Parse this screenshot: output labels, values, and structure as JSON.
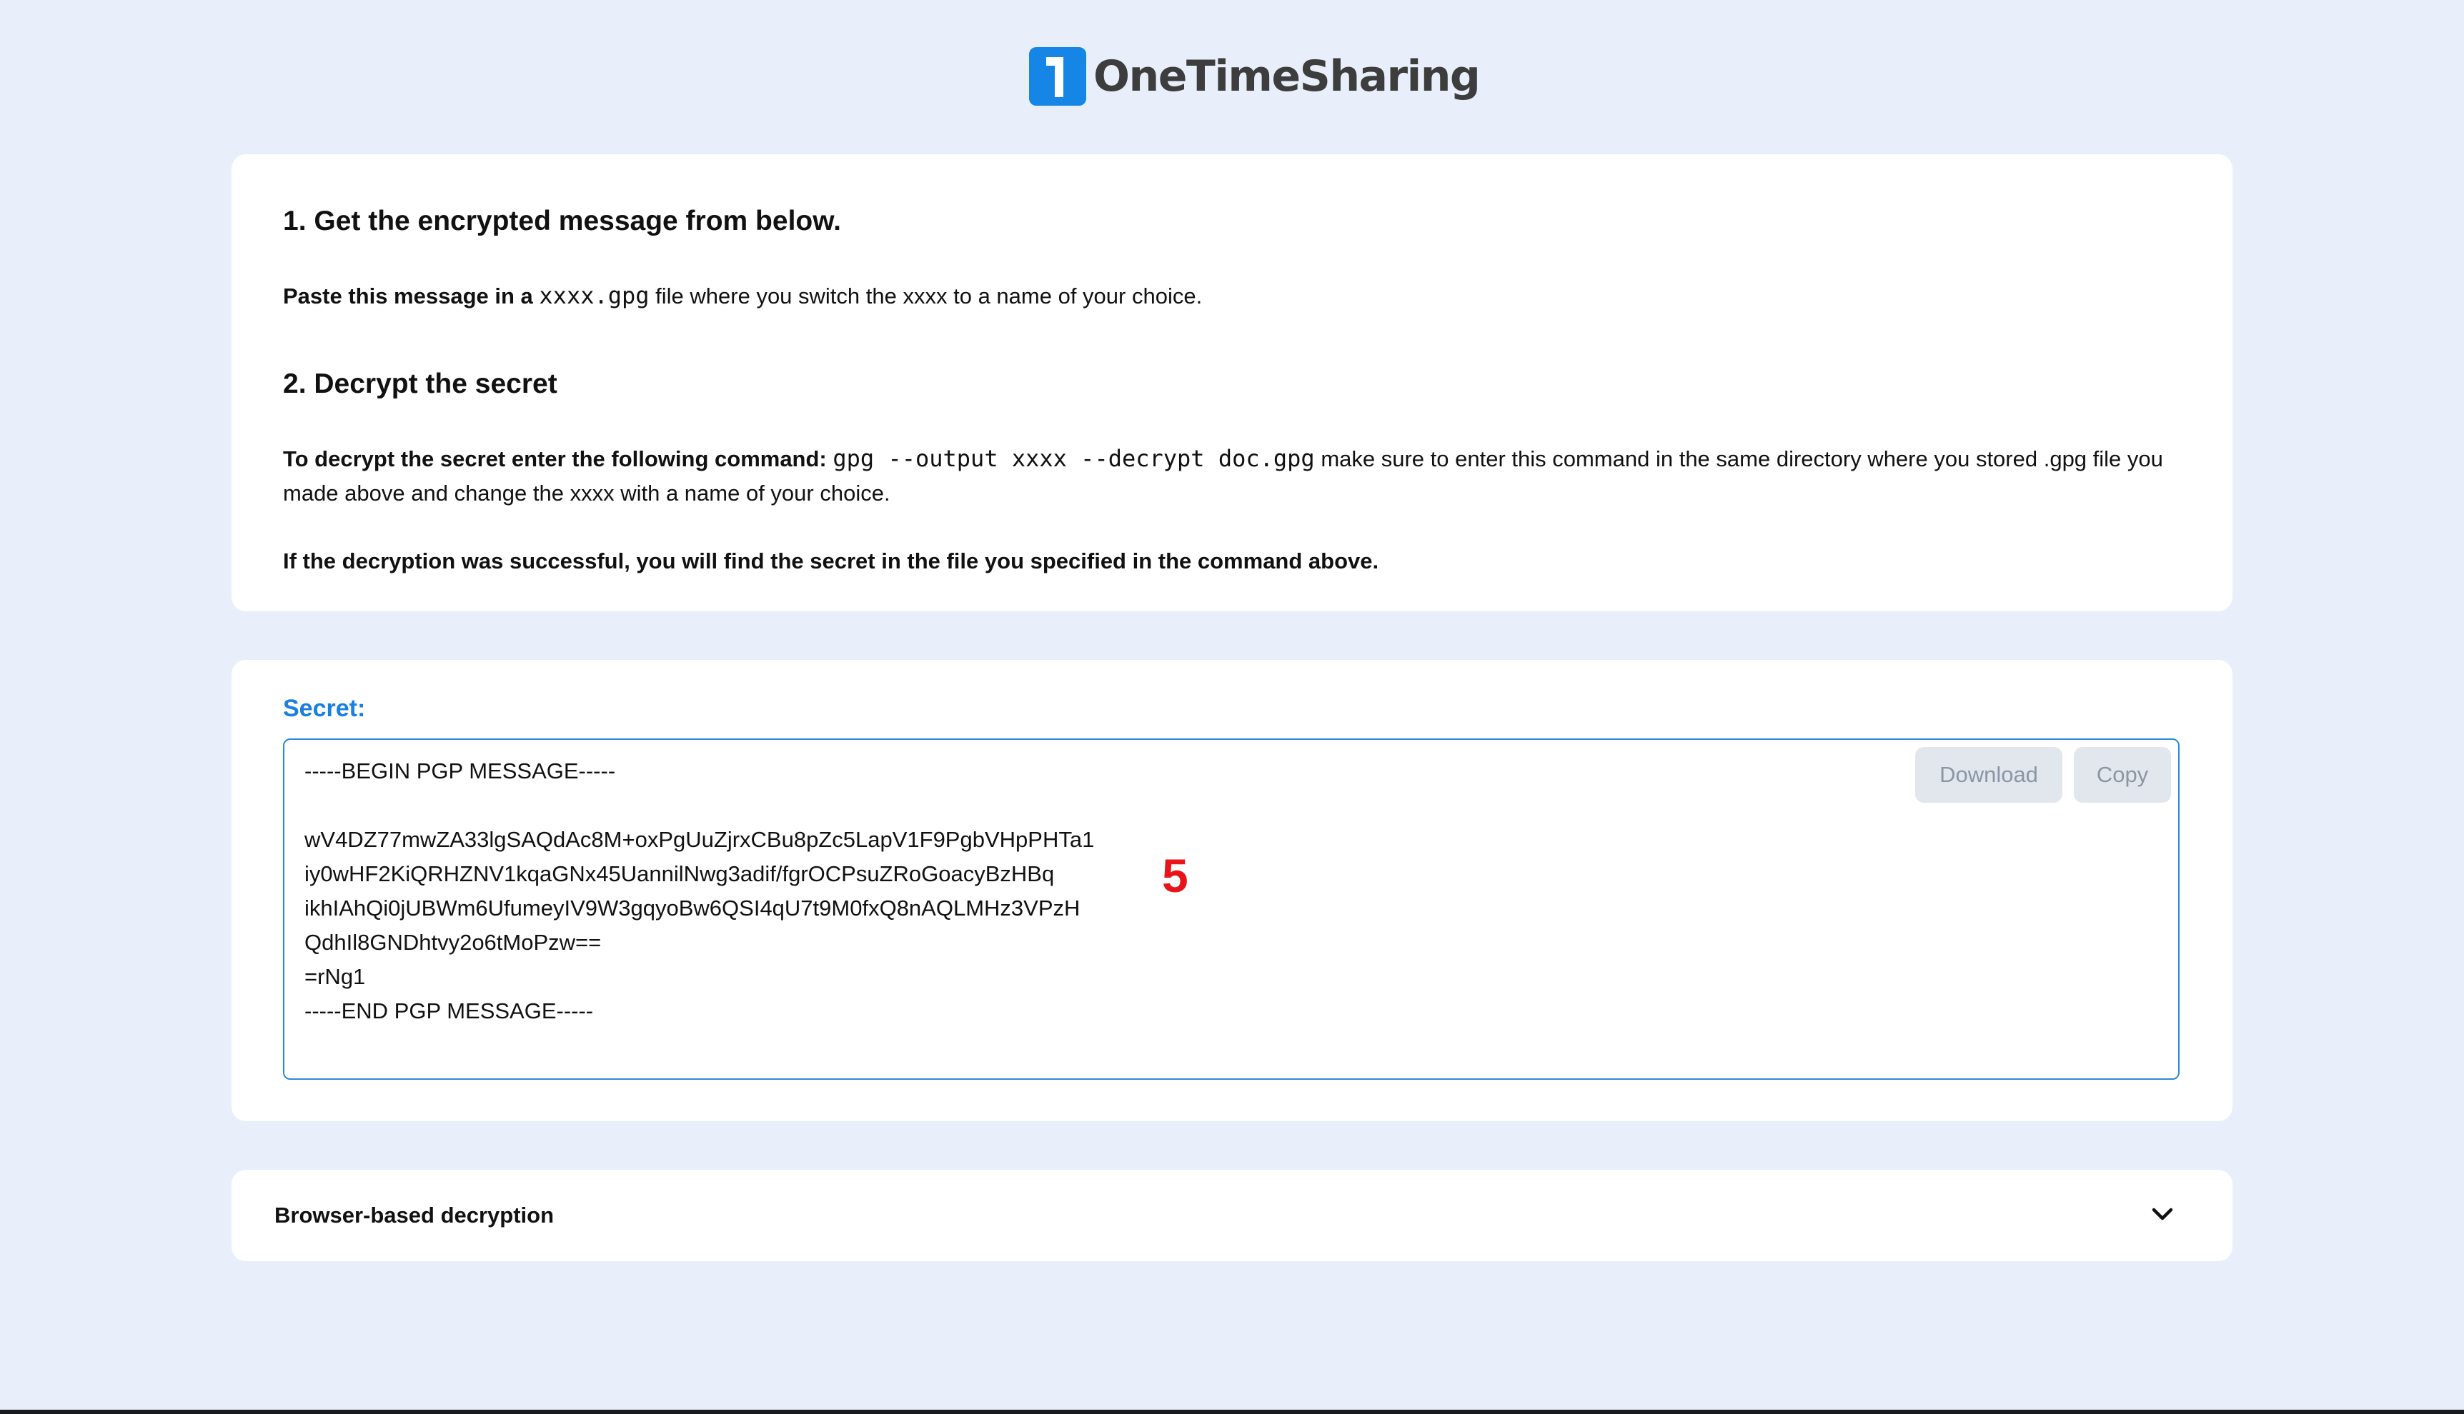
{
  "brand": {
    "name": "OneTimeSharing",
    "logo_glyph": "1",
    "logo_icon": "onetimesharing-logo-icon",
    "accent": "#1686e6"
  },
  "instructions": {
    "step1": {
      "heading": "1. Get the encrypted message from below.",
      "text_bold": "Paste this message in a",
      "code": "xxxx.gpg",
      "text_rest": "file where you switch the xxxx to a name of your choice."
    },
    "step2": {
      "heading": "2. Decrypt the secret",
      "text_bold": "To decrypt the secret enter the following command:",
      "code": "gpg --output xxxx --decrypt doc.gpg",
      "text_rest": "make sure to enter this command in the same directory where you stored .gpg file you made above and change the xxxx with a name of your choice.",
      "success_note": "If the decryption was successful, you will find the secret in the file you specified in the command above."
    }
  },
  "secret": {
    "label": "Secret:",
    "lines": [
      "-----BEGIN PGP MESSAGE-----",
      "",
      "wV4DZ77mwZA33lgSAQdAc8M+oxPgUuZjrxCBu8pZc5LapV1F9PgbVHpPHTa1",
      "iy0wHF2KiQRHZNV1kqaGNx45UannilNwg3adif/fgrOCPsuZRoGoacyBzHBq",
      "ikhIAhQi0jUBWm6UfumeyIV9W3gqyoBw6QSI4qU7t9M0fxQ8nAQLMHz3VPzH",
      "QdhIl8GNDhtvy2o6tMoPzw==",
      "=rNg1",
      "-----END PGP MESSAGE-----"
    ],
    "download_label": "Download",
    "copy_label": "Copy"
  },
  "annotation": {
    "marker": "5",
    "color": "#e8141a"
  },
  "browser_decryption": {
    "title": "Browser-based decryption",
    "toggle_icon": "chevron-down-icon"
  }
}
